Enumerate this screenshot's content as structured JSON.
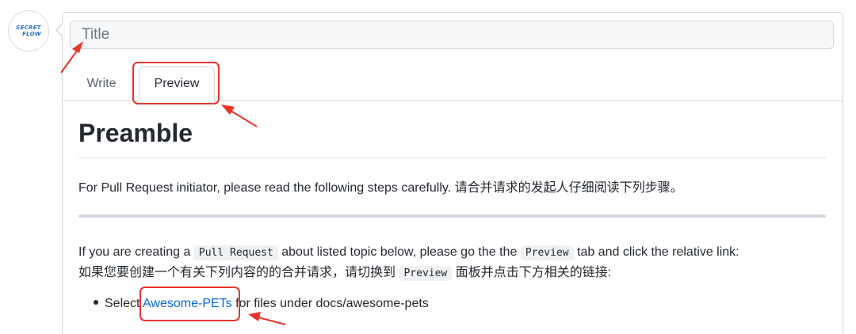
{
  "avatar": {
    "line1": "SECRET",
    "line2": "FLOW"
  },
  "title_input": {
    "placeholder": "Title"
  },
  "tabs": [
    {
      "label": "Write"
    },
    {
      "label": "Preview"
    }
  ],
  "preview": {
    "heading": "Preamble",
    "para1": "For Pull Request initiator, please read the following steps carefully. 请合并请求的发起人仔细阅读下列步骤。",
    "para2": {
      "en_prefix": "If you are creating a",
      "code1": "Pull Request",
      "en_mid": "about listed topic below, please go the the",
      "code2": "Preview",
      "en_suffix": "tab and click the relative link:",
      "zh_prefix": "如果您要创建一个有关下列内容的的合并请求，请切换到",
      "code3": "Preview",
      "zh_suffix": "面板并点击下方相关的链接:"
    },
    "bullet": {
      "prefix": "Select",
      "link": "Awesome-PETs",
      "suffix": "for files under docs/awesome-pets"
    }
  },
  "colors": {
    "annotation": "#e8352a",
    "link": "#0969da",
    "avatar_text": "#1f6fd8"
  }
}
